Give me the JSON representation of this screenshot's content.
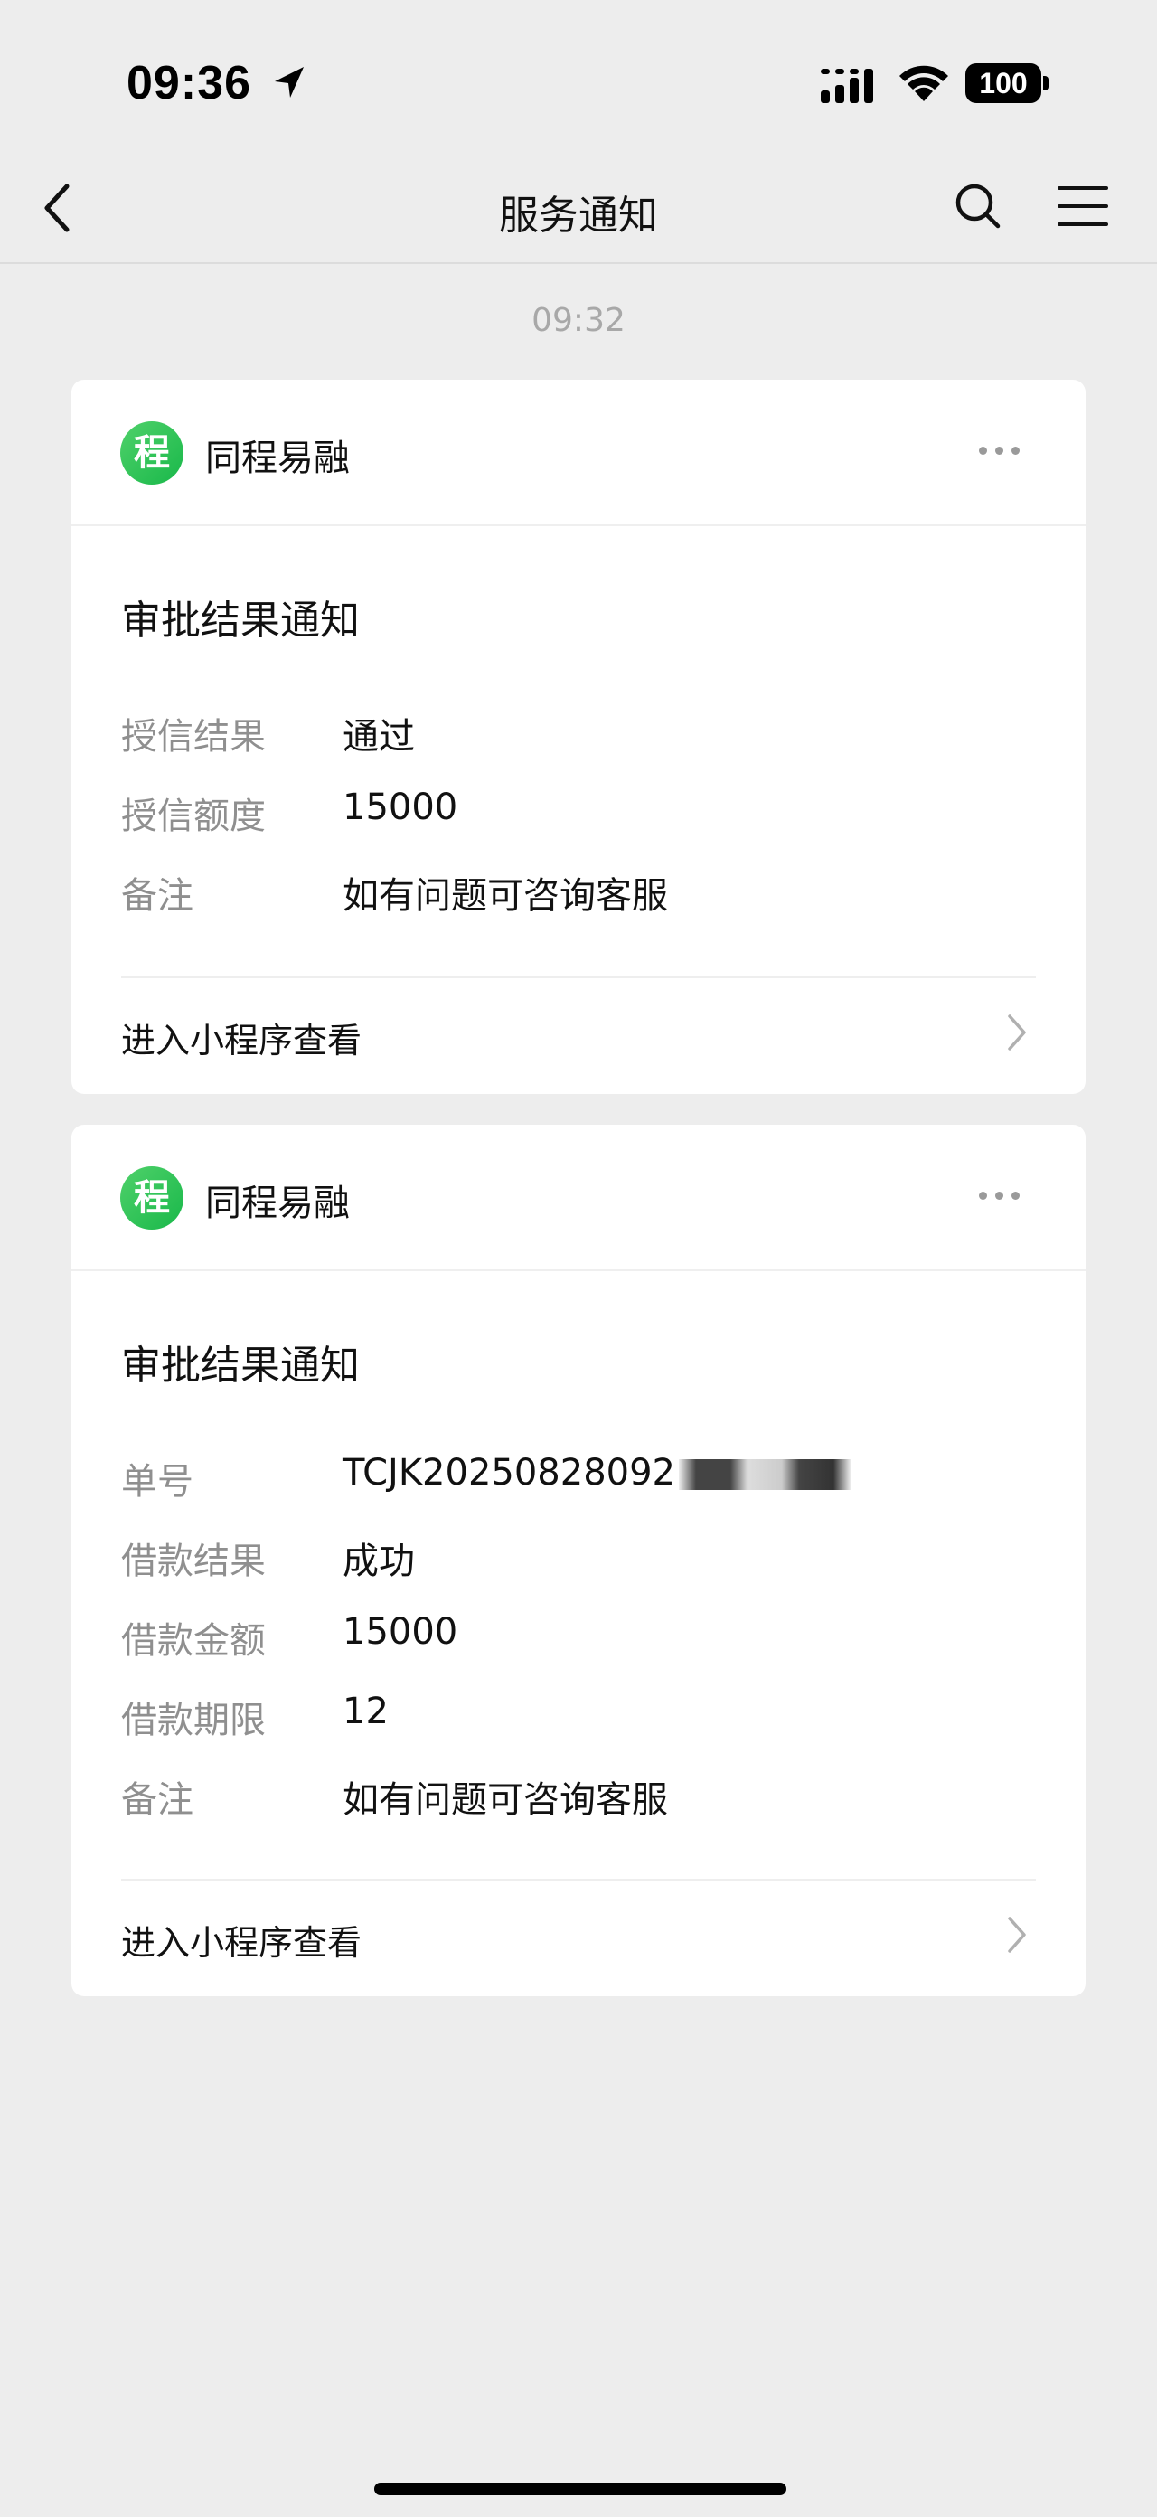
{
  "status_bar": {
    "time": "09:36",
    "battery": "100"
  },
  "nav": {
    "title": "服务通知"
  },
  "timestamp": "09:32",
  "cards": [
    {
      "app_name": "同程易融",
      "logo_char": "程",
      "title": "审批结果通知",
      "fields": [
        {
          "label": "授信结果",
          "value": "通过"
        },
        {
          "label": "授信额度",
          "value": "15000"
        },
        {
          "label": "备注",
          "value": "如有问题可咨询客服"
        }
      ],
      "link": "进入小程序查看"
    },
    {
      "app_name": "同程易融",
      "logo_char": "程",
      "title": "审批结果通知",
      "fields": [
        {
          "label": "单号",
          "value": "TCJK20250828092"
        },
        {
          "label": "借款结果",
          "value": "成功"
        },
        {
          "label": "借款金额",
          "value": "15000"
        },
        {
          "label": "借款期限",
          "value": "12"
        },
        {
          "label": "备注",
          "value": "如有问题可咨询客服"
        }
      ],
      "link": "进入小程序查看"
    }
  ]
}
